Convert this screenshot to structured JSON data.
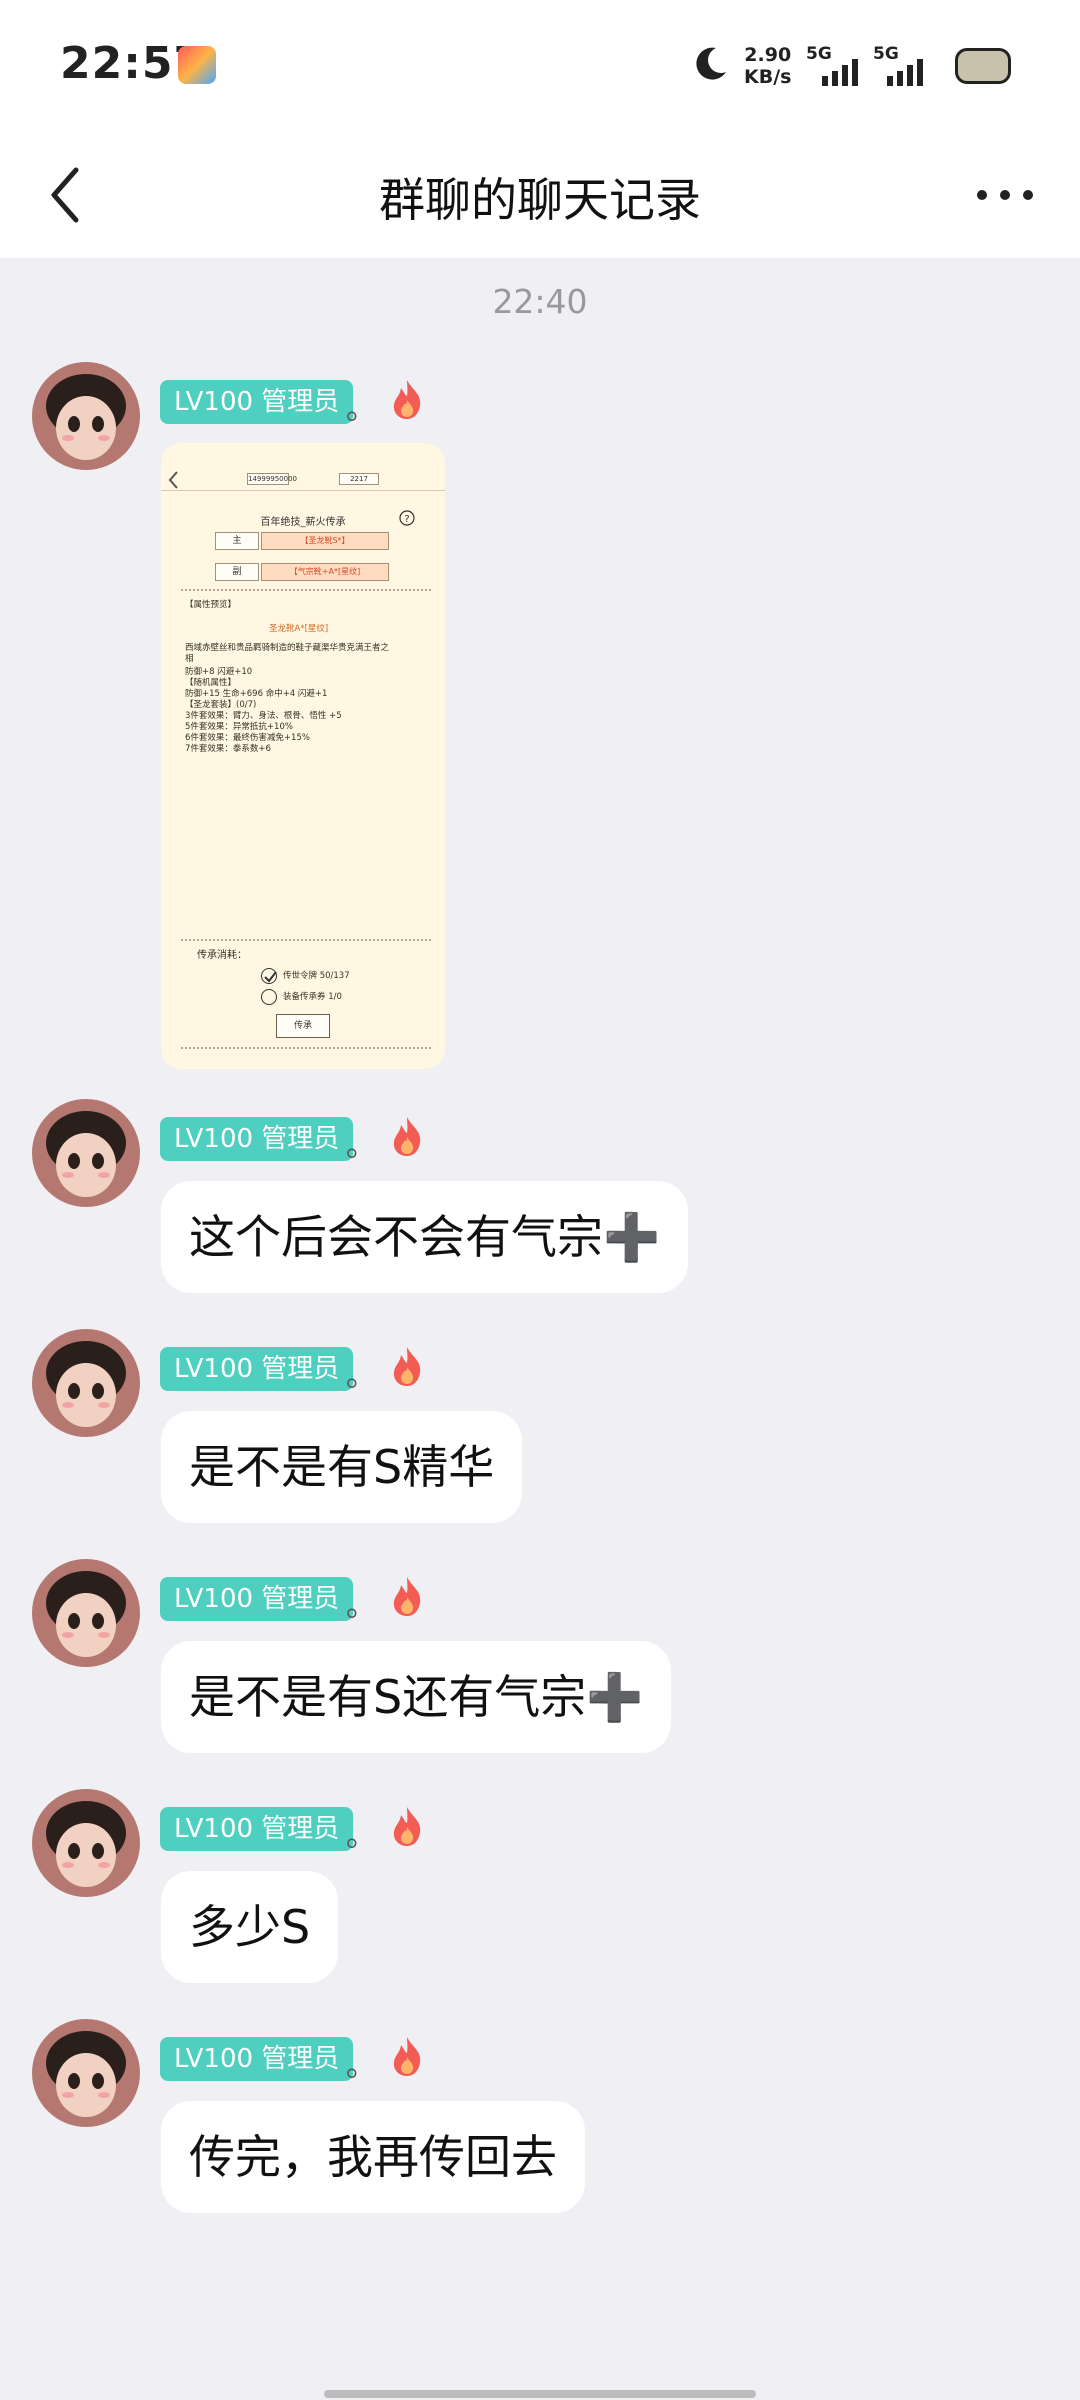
{
  "status_bar": {
    "time": "22:57",
    "net_speed_value": "2.90",
    "net_speed_unit": "KB/s",
    "signal_label_1": "5G",
    "signal_label_2": "5G"
  },
  "header": {
    "title": "群聊的聊天记录"
  },
  "chat": {
    "timestamp": "22:40",
    "sender_badge": "LV100 管理员",
    "sender_suffix": "。",
    "image_message": {
      "title": "百年绝技_薪火传承",
      "currency_1": "14999950000",
      "currency_2": "2217",
      "main_label": "主",
      "main_value": "【圣龙靴S*】",
      "sub_label": "副",
      "sub_value": "【气宗靴+A*[星纹]",
      "preview_heading": "【属性预览】",
      "item_name": "圣龙靴A*[星纹]",
      "lines": [
        "西域赤壁丝和贵品羁骑制造的鞋子藏渠华贵克满王者之",
        "相",
        "防御+8 闪避+10",
        "【随机属性】",
        "  防御+15 生命+696 命中+4 闪避+1",
        "【圣龙套装】(0/7)",
        "3件套效果：臂力、身法、根骨、悟性 +5",
        "5件套效果：异常抵抗+10%",
        "6件套效果：最终伤害减免+15%",
        "7件套效果：拳系数+6"
      ],
      "cost_heading": "传承消耗：",
      "cost_1": "传世令牌 50/137",
      "cost_2": "装备传承券 1/0",
      "button_label": "传承"
    },
    "messages": [
      {
        "text": "这个后会不会有气宗➕"
      },
      {
        "text": "是不是有S精华"
      },
      {
        "text": "是不是有S还有气宗➕"
      },
      {
        "text": "多少S"
      },
      {
        "text": "传完，我再传回去"
      }
    ]
  },
  "colors": {
    "badge": "#4fcfbf",
    "background": "#efeff4",
    "bubble": "#ffffff"
  },
  "icons": [
    "back-arrow-icon",
    "more-icon",
    "moon-icon",
    "signal-icon",
    "battery-icon",
    "fire-icon",
    "avatar"
  ]
}
